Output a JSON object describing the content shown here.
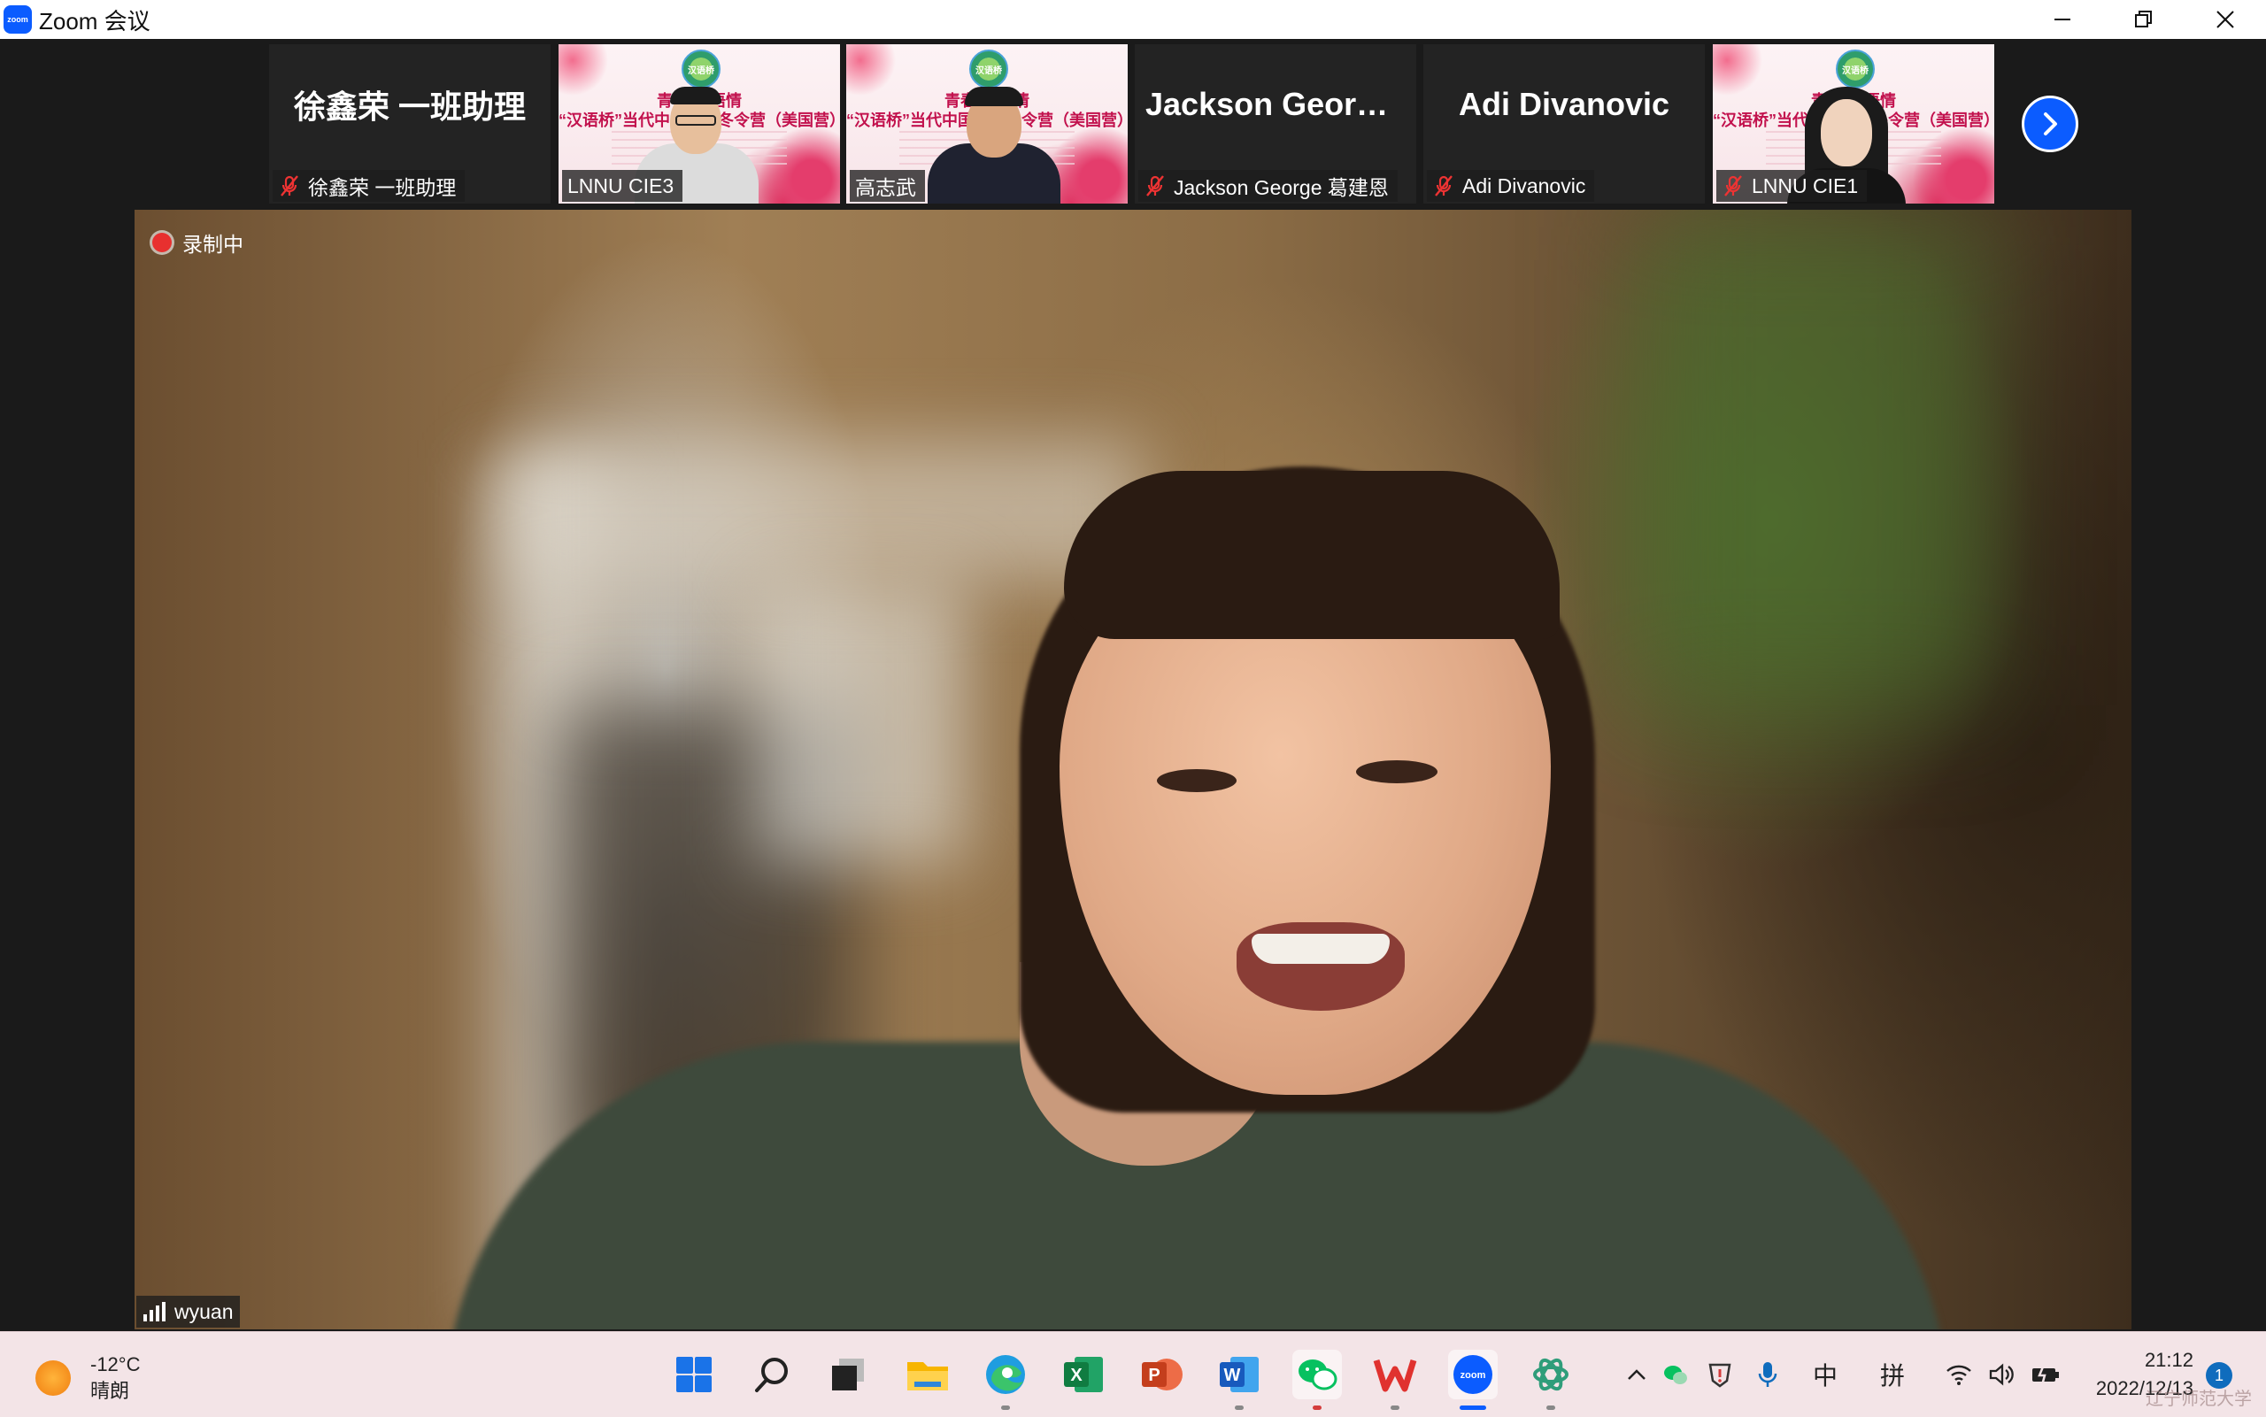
{
  "window": {
    "logo_text": "zoom",
    "title": "Zoom 会议"
  },
  "gallery": {
    "tiles": [
      {
        "name_display": "徐鑫荣 一班助理",
        "label": "徐鑫荣 一班助理",
        "muted": true,
        "video": false
      },
      {
        "label": "LNNU CIE3",
        "muted": false,
        "video": true
      },
      {
        "label": "高志武",
        "muted": false,
        "video": true
      },
      {
        "name_display": "Jackson  George...",
        "label": "Jackson George 葛建恩",
        "muted": true,
        "video": false
      },
      {
        "name_display": "Adi Divanovic",
        "label": "Adi Divanovic",
        "muted": true,
        "video": false
      },
      {
        "label": "LNNU CIE1",
        "muted": true,
        "video": true
      }
    ],
    "banner": {
      "logo_text": "汉语桥",
      "line1": "青春·汉语情",
      "line2": "“汉语桥”当代中国主题冬令营（美国营）"
    }
  },
  "main_video": {
    "recording_label": "录制中",
    "speaker_name": "wyuan"
  },
  "taskbar": {
    "weather_temp": "-12°C",
    "weather_desc": "晴朗",
    "ime_lang": "中",
    "ime_mode": "拼",
    "time": "21:12",
    "date": "2022/12/13",
    "notification_count": "1",
    "watermark": "辽宁师范大学"
  },
  "colors": {
    "zoom_blue": "#0b5cff",
    "record_red": "#e8302f",
    "taskbar_bg": "#f3e4e7"
  }
}
